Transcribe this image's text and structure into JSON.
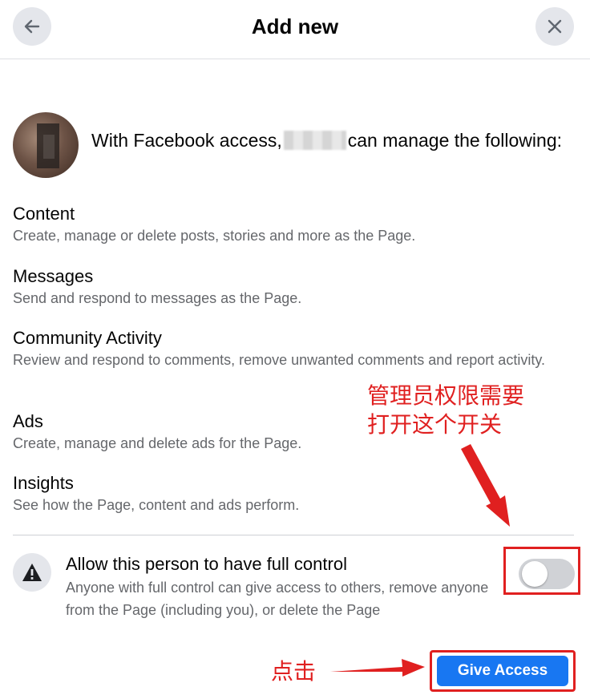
{
  "header": {
    "title": "Add new",
    "back_icon": "arrow-left-icon",
    "close_icon": "close-icon"
  },
  "intro": {
    "text_before": "With Facebook access,",
    "text_after": "can manage the following:"
  },
  "permissions": [
    {
      "title": "Content",
      "description": "Create, manage or delete posts, stories and more as the Page."
    },
    {
      "title": "Messages",
      "description": "Send and respond to messages as the Page."
    },
    {
      "title": "Community Activity",
      "description": "Review and respond to comments, remove unwanted comments and report activity."
    },
    {
      "title": "Ads",
      "description": "Create, manage and delete ads for the Page."
    },
    {
      "title": "Insights",
      "description": "See how the Page, content and ads perform."
    }
  ],
  "full_control": {
    "title": "Allow this person to have full control",
    "description": "Anyone with full control can give access to others, remove anyone from the Page (including you), or delete the Page",
    "icon": "warning-icon",
    "toggle_on": false
  },
  "actions": {
    "give_access_label": "Give Access"
  },
  "annotations": {
    "toggle_note": "管理员权限需要打开这个开关",
    "click_note": "点击",
    "color": "#e02020"
  },
  "colors": {
    "primary": "#1877f2",
    "secondary_text": "#65676b",
    "icon_bg": "#e4e6eb"
  }
}
